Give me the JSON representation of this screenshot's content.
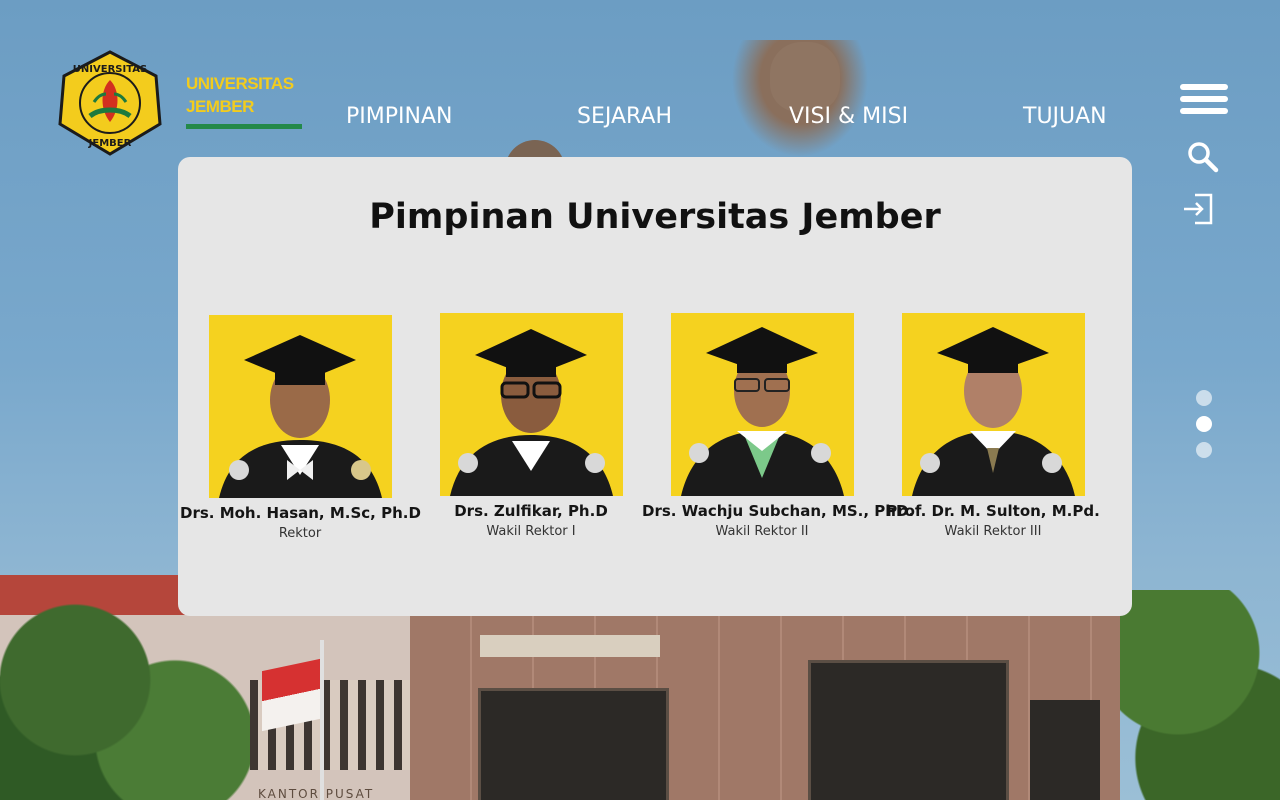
{
  "brand": {
    "line1": "UNIVERSITAS",
    "line2": "JEMBER",
    "logo_text_top": "UNIVERSITAS",
    "logo_text_bottom": "JEMBER",
    "colors": {
      "yellow": "#f3cc1d",
      "green": "#23894a"
    }
  },
  "nav": {
    "items": [
      "PIMPINAN",
      "SEJARAH",
      "VISI & MISI",
      "TUJUAN"
    ]
  },
  "icons": {
    "menu": "hamburger-icon",
    "search": "search-icon",
    "login": "login-icon"
  },
  "section": {
    "title": "Pimpinan Universitas Jember",
    "people": [
      {
        "name": "Drs. Moh. Hasan, M.Sc, Ph.D",
        "role": "Rektor"
      },
      {
        "name": "Drs. Zulfikar, Ph.D",
        "role": "Wakil Rektor I"
      },
      {
        "name": "Drs. Wachju Subchan, MS., PhD.",
        "role": "Wakil Rektor II"
      },
      {
        "name": "Prof. Dr. M. Sulton, M.Pd.",
        "role": "Wakil Rektor III"
      }
    ]
  },
  "slider": {
    "count": 3,
    "active_index": 1
  },
  "background": {
    "sign_text": "KANTOR PUSAT"
  }
}
